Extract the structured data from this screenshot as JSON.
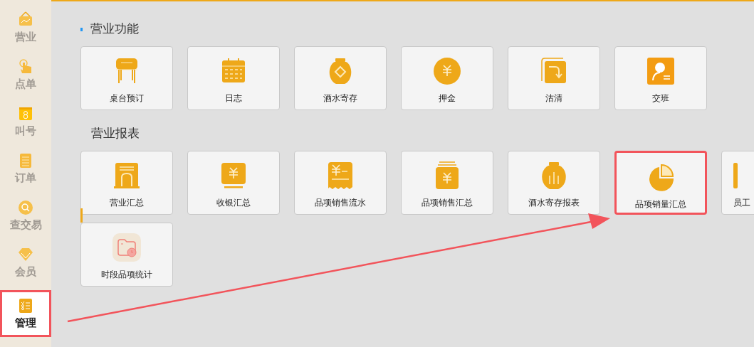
{
  "sidebar": {
    "items": [
      {
        "label": "营业",
        "selected": false,
        "highlighted": false
      },
      {
        "label": "点单",
        "selected": false,
        "highlighted": false
      },
      {
        "label": "叫号",
        "selected": false,
        "highlighted": false
      },
      {
        "label": "订单",
        "selected": false,
        "highlighted": false
      },
      {
        "label": "查交易",
        "selected": false,
        "highlighted": false
      },
      {
        "label": "会员",
        "selected": false,
        "highlighted": false
      },
      {
        "label": "管理",
        "selected": true,
        "highlighted": true
      }
    ]
  },
  "sections": [
    {
      "title": "营业功能",
      "rows": [
        [
          {
            "label": "桌台预订",
            "highlighted": false
          },
          {
            "label": "日志",
            "highlighted": false
          },
          {
            "label": "酒水寄存",
            "highlighted": false
          },
          {
            "label": "押金",
            "highlighted": false
          },
          {
            "label": "沽清",
            "highlighted": false
          },
          {
            "label": "交班",
            "highlighted": false
          }
        ]
      ]
    },
    {
      "title": "营业报表",
      "rows": [
        [
          {
            "label": "营业汇总",
            "highlighted": false
          },
          {
            "label": "收银汇总",
            "highlighted": false
          },
          {
            "label": "品项销售流水",
            "highlighted": false
          },
          {
            "label": "品项销售汇总",
            "highlighted": false
          },
          {
            "label": "酒水寄存报表",
            "highlighted": false
          },
          {
            "label": "品项销量汇总",
            "highlighted": true
          },
          {
            "label": "员工",
            "highlighted": false,
            "kind": "cut"
          }
        ],
        [
          {
            "label": "时段品项统计",
            "highlighted": false
          }
        ]
      ]
    }
  ]
}
